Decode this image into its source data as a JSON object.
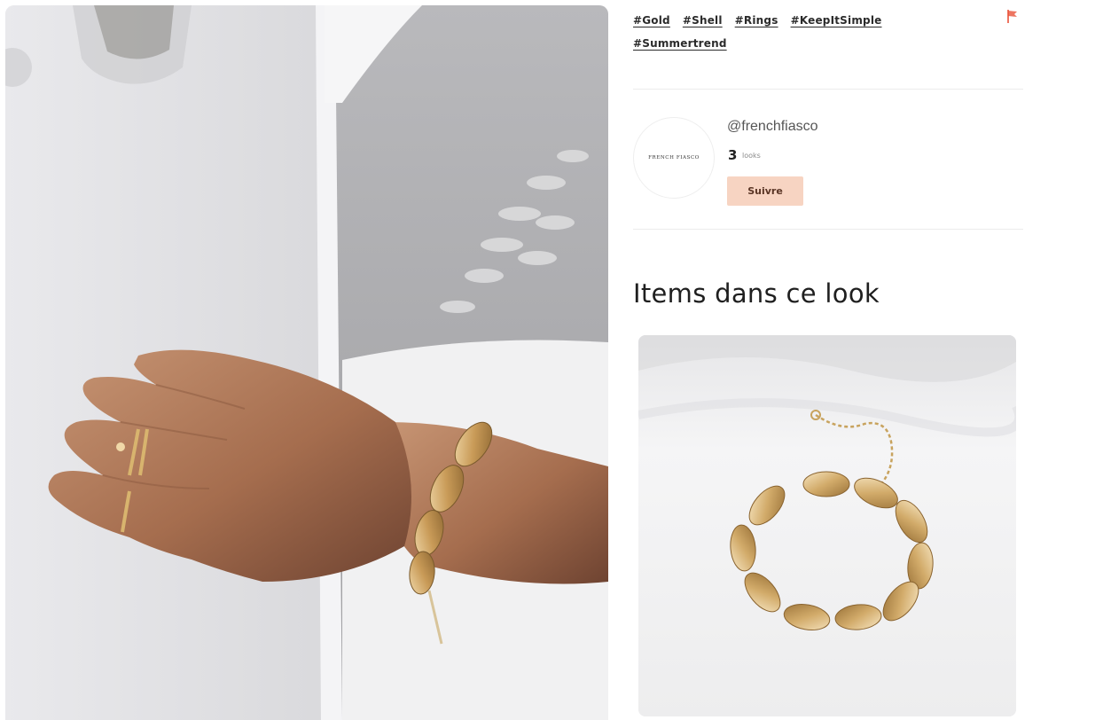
{
  "tags": [
    "#Gold",
    "#Shell",
    "#Rings",
    "#KeepItSimple",
    "#Summertrend"
  ],
  "author": {
    "avatar_text": "FRENCH FIASCO",
    "handle": "@frenchfiasco",
    "looks_count": "3",
    "looks_label": "looks",
    "follow_label": "Suivre"
  },
  "items_section": {
    "title": "Items dans ce look"
  },
  "colors": {
    "accent": "#f7d4c2",
    "flag": "#e9533a"
  }
}
